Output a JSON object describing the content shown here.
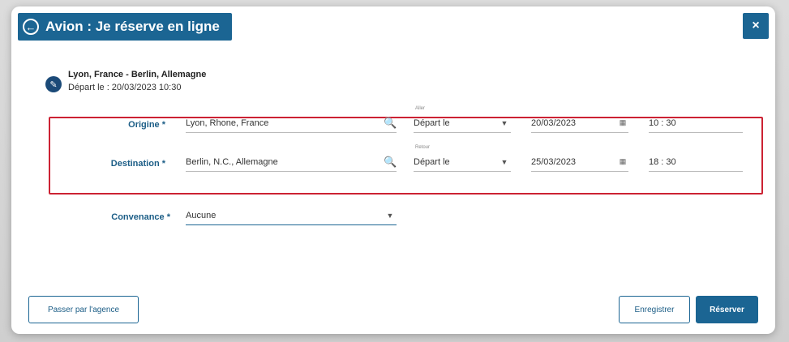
{
  "dialog": {
    "title": "Avion : Je réserve en ligne",
    "close_label": "×",
    "back_icon": "arrow-left-circle-icon"
  },
  "summary": {
    "route": "Lyon, France - Berlin, Allemagne",
    "departure": "Départ le : 20/03/2023 10:30"
  },
  "origin": {
    "label": "Origine *",
    "value": "Lyon, Rhone, France",
    "direction_label": "Aller",
    "mode": "Départ le",
    "date": "20/03/2023",
    "time": "10 : 30"
  },
  "destination": {
    "label": "Destination *",
    "value": "Berlin, N.C., Allemagne",
    "direction_label": "Retour",
    "mode": "Départ le",
    "date": "25/03/2023",
    "time": "18 : 30"
  },
  "convenance": {
    "label": "Convenance *",
    "value": "Aucune"
  },
  "footer": {
    "agency_label": "Passer par l'agence",
    "save_label": "Enregistrer",
    "book_label": "Réserver"
  },
  "colors": {
    "accent": "#1b6593",
    "highlight": "#cc2233"
  }
}
